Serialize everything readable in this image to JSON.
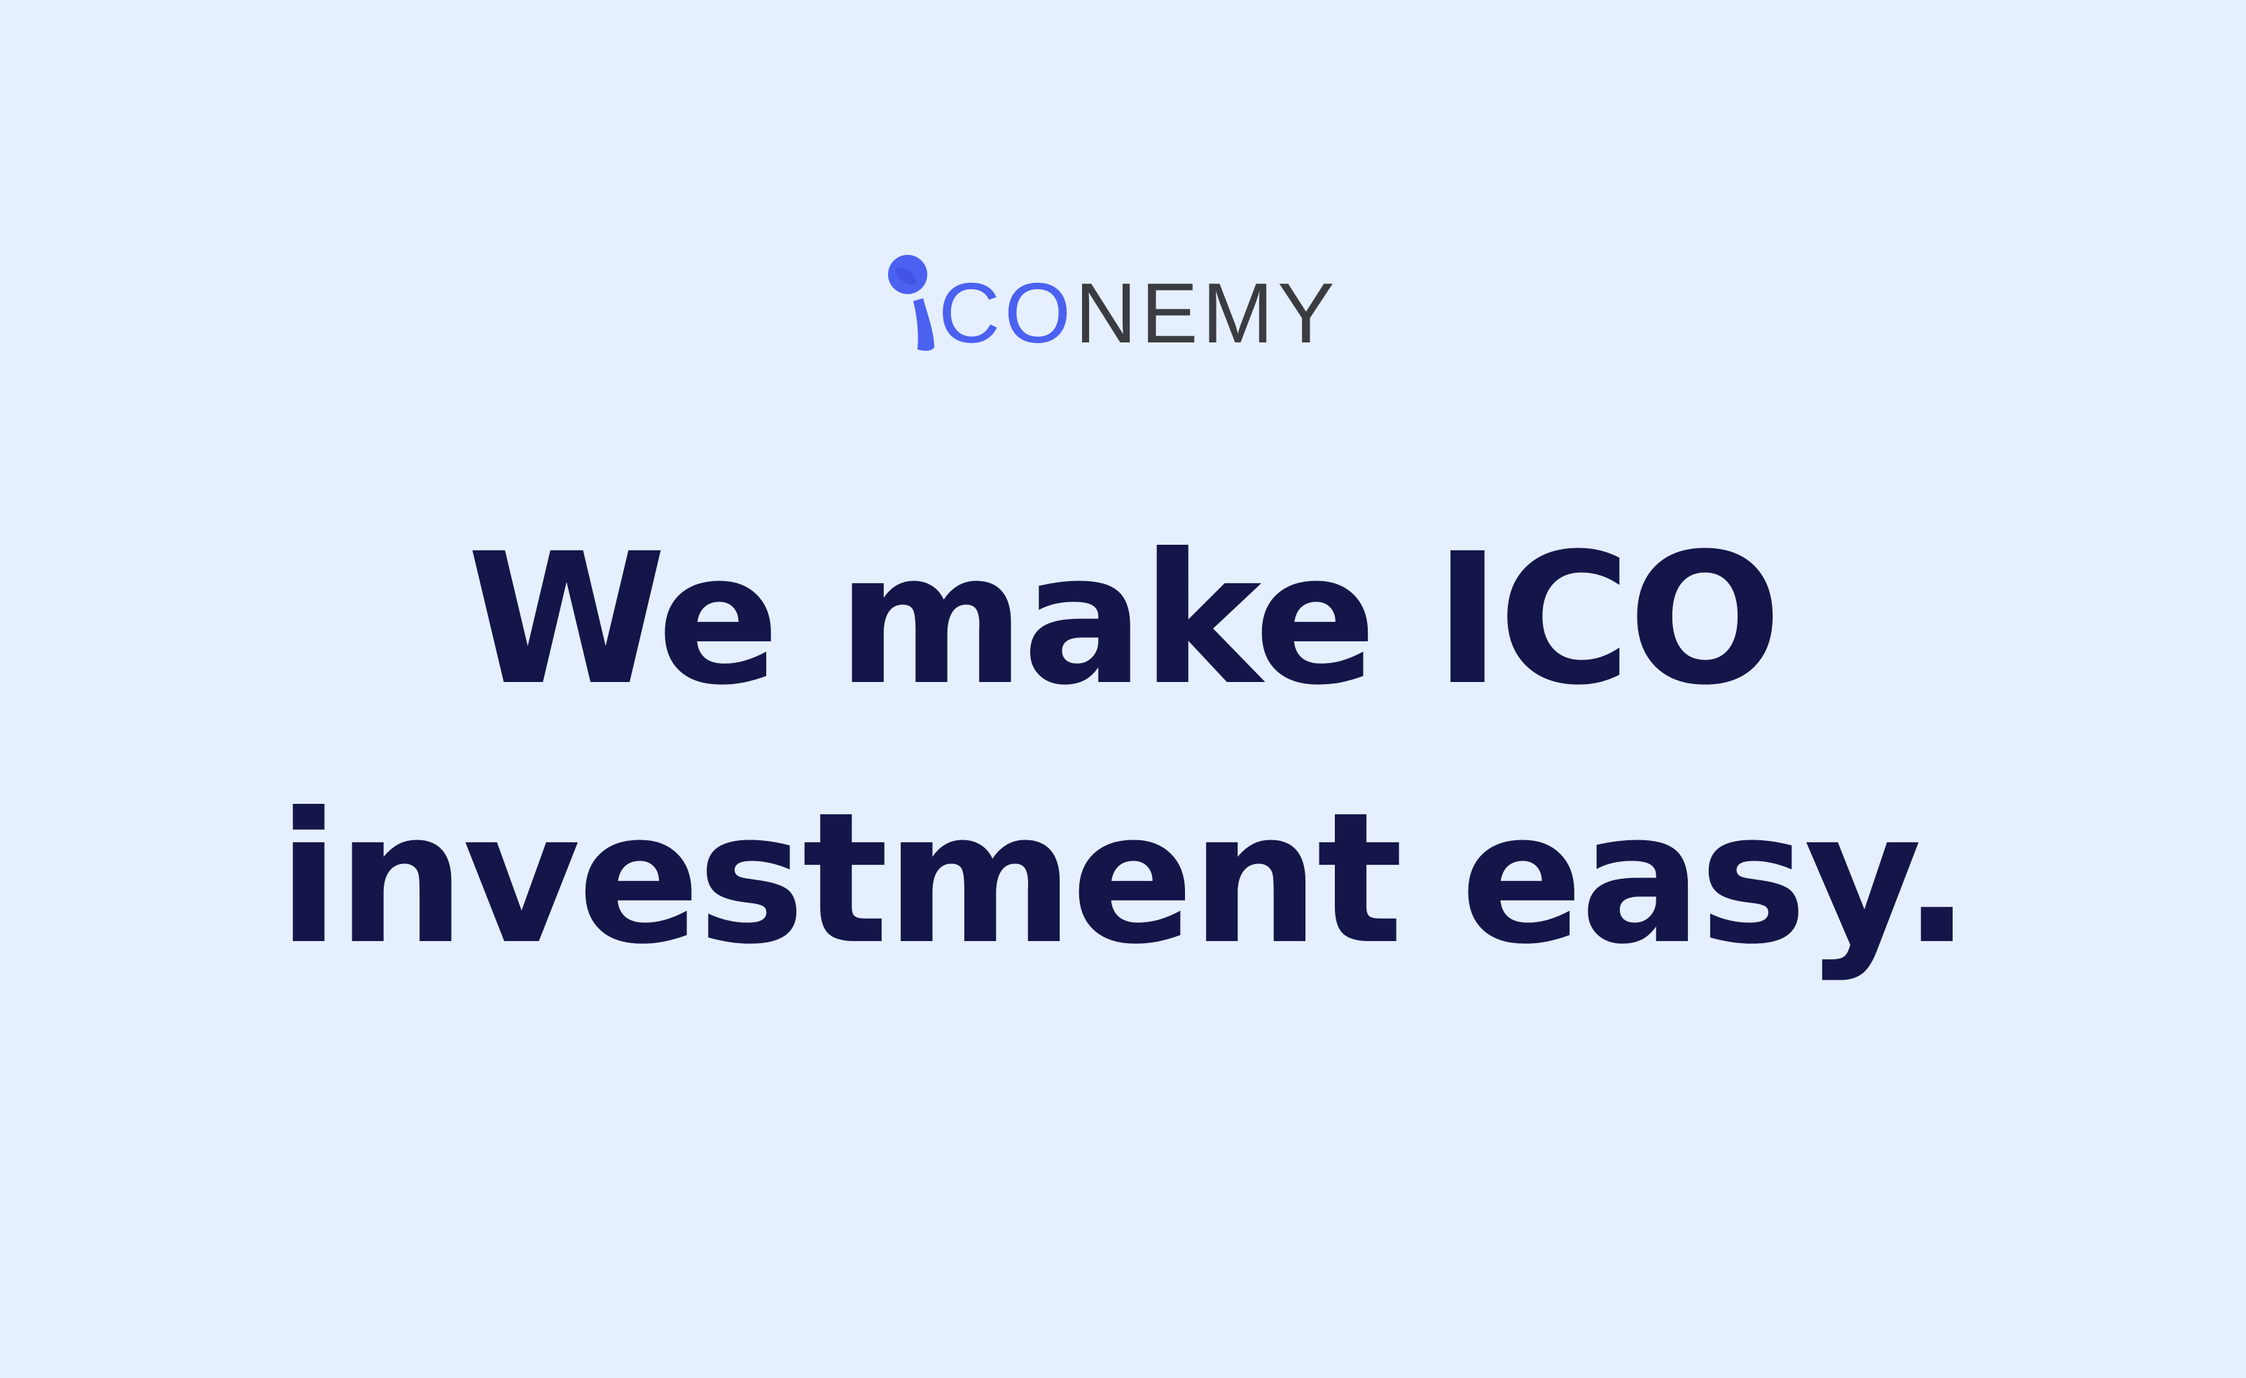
{
  "colors": {
    "background": "#E5EFFE",
    "headline": "#14164A",
    "logo_accent": "#4B61F0",
    "logo_accent_dark": "#3F4EE0",
    "logo_rest": "#3A3C41"
  },
  "logo": {
    "accent_text": "CO",
    "rest_text": "NEMY",
    "icon": "person-i-icon"
  },
  "headline": {
    "line1": "We make ICO",
    "line2": "investment easy."
  }
}
